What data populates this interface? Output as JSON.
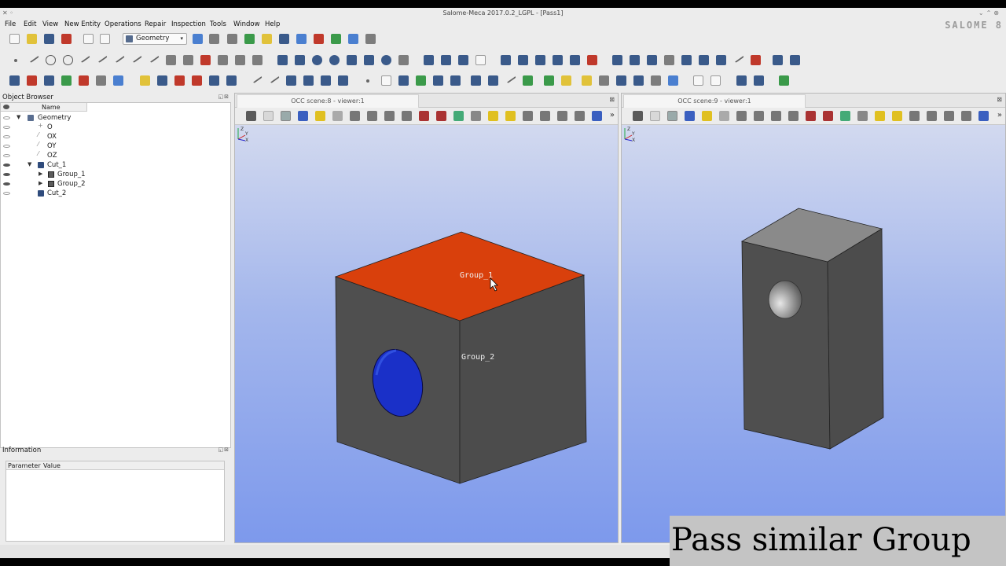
{
  "window": {
    "title": "Salome-Meca 2017.0.2_LGPL - [Pass1]",
    "brand": "SALOME 8"
  },
  "menu": [
    "File",
    "Edit",
    "View",
    "New Entity",
    "Operations",
    "Repair",
    "Inspection",
    "Tools",
    "Window",
    "Help"
  ],
  "toolbar": {
    "module_combo": "Geometry"
  },
  "object_browser": {
    "title": "Object Browser",
    "column_name": "Name",
    "items": [
      {
        "label": "Geometry",
        "visible": false
      },
      {
        "label": "O",
        "visible": false
      },
      {
        "label": "OX",
        "visible": false
      },
      {
        "label": "OY",
        "visible": false
      },
      {
        "label": "OZ",
        "visible": false
      },
      {
        "label": "Cut_1",
        "visible": true
      },
      {
        "label": "Group_1",
        "visible": true
      },
      {
        "label": "Group_2",
        "visible": true
      },
      {
        "label": "Cut_2",
        "visible": false
      }
    ]
  },
  "information": {
    "title": "Information",
    "col_parameter": "Parameter",
    "col_value": "Value"
  },
  "viewers": [
    {
      "tab": "OCC scene:8 - viewer:1",
      "labels": {
        "group1": "Group_1",
        "group2": "Group_2"
      }
    },
    {
      "tab": "OCC scene:9 - viewer:1"
    }
  ],
  "axis_labels": {
    "z": "Z",
    "y": "Y",
    "x": "X"
  },
  "colors": {
    "selected_face": "#d9400c",
    "hole_blue": "#1a30c8",
    "solid_dark": "#4f4f4f",
    "solid_light": "#8a8a8a",
    "scene_top": "#d2d9ef",
    "scene_bottom": "#7d99ec"
  },
  "caption": "Pass similar Group"
}
